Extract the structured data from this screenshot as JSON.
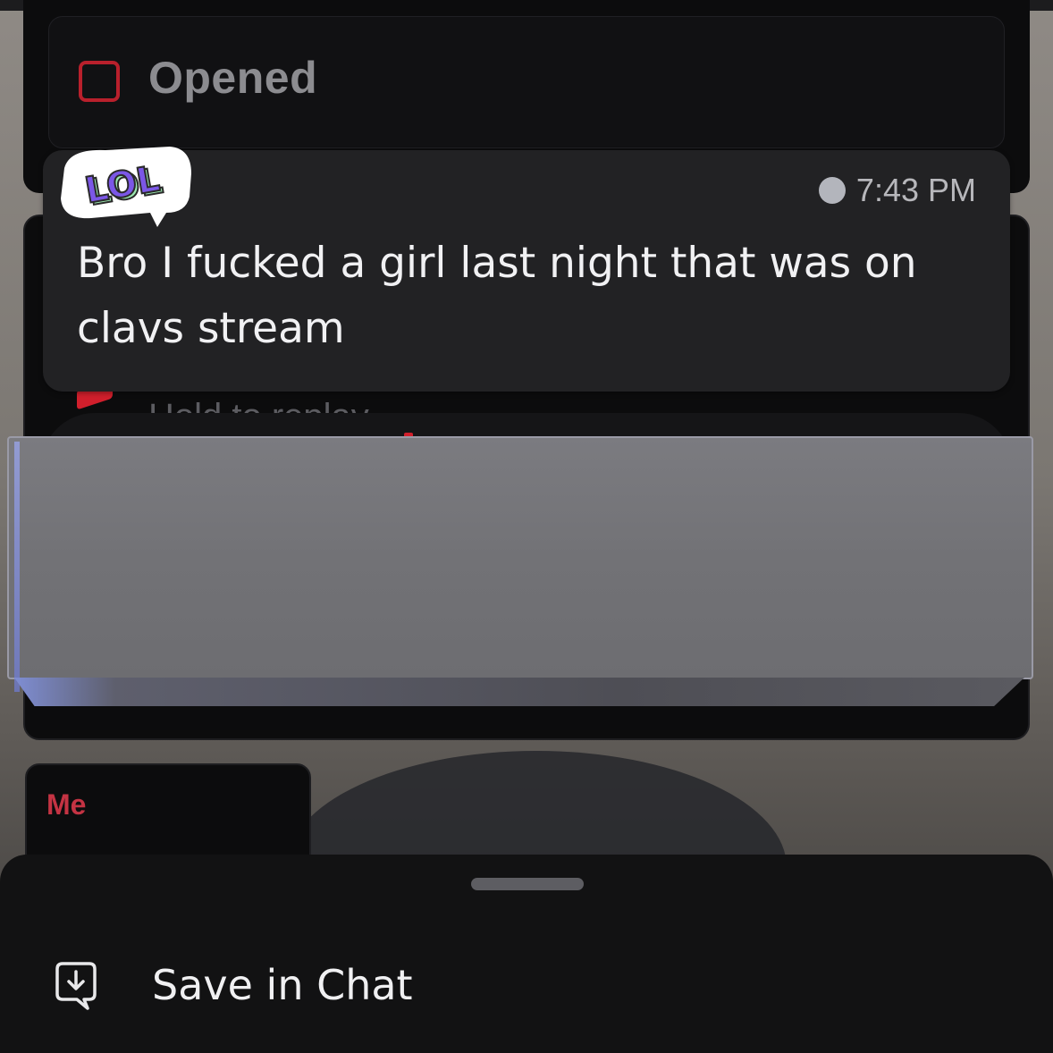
{
  "status_card": {
    "label": "Opened"
  },
  "hidden_card": {
    "hint": "Hold to replay"
  },
  "message": {
    "sticker_text": "LOL",
    "time": "7:43 PM",
    "text": "Bro I fucked a girl last night that was on clavs stream"
  },
  "me_card": {
    "label": "Me"
  },
  "action_sheet": {
    "save_label": "Save in Chat",
    "save_icon": "save-in-chat-icon"
  },
  "colors": {
    "accent_red": "#c61f2c",
    "bubble_bg": "#222224",
    "sheet_bg": "#121213",
    "sticker_purple": "#7b57e6",
    "sticker_green": "#9be8b0"
  }
}
